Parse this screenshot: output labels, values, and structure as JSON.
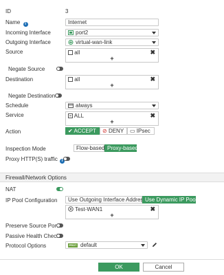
{
  "fields": {
    "id_label": "ID",
    "id_value": "3",
    "name_label": "Name",
    "name_value": "Internet",
    "incoming_label": "Incoming Interface",
    "incoming_value": "port2",
    "outgoing_label": "Outgoing Interface",
    "outgoing_value": "virtual-wan-link",
    "source_label": "Source",
    "source_value": "all",
    "negate_source_label": "Negate Source",
    "destination_label": "Destination",
    "destination_value": "all",
    "negate_destination_label": "Negate Destination",
    "schedule_label": "Schedule",
    "schedule_value": "always",
    "service_label": "Service",
    "service_value": "ALL",
    "action_label": "Action",
    "action_accept": "ACCEPT",
    "action_deny": "DENY",
    "action_ipsec": "IPsec",
    "inspection_label": "Inspection Mode",
    "inspection_flow": "Flow-based",
    "inspection_proxy": "Proxy-based",
    "proxy_http_label": "Proxy HTTP(S) traffic"
  },
  "section": {
    "title": "Firewall/Network Options",
    "nat_label": "NAT",
    "ip_pool_label": "IP Pool Configuration",
    "ip_pool_option1": "Use Outgoing Interface Address",
    "ip_pool_option2": "Use Dynamic IP Pool",
    "ip_pool_value": "Test-WAN1",
    "preserve_port_label": "Preserve Source Port",
    "passive_health_label": "Passive Health Check",
    "protocol_options_label": "Protocol Options",
    "protocol_options_badge": "PROT",
    "protocol_options_value": "default"
  },
  "footer": {
    "ok_label": "OK",
    "cancel_label": "Cancel"
  },
  "colors": {
    "accent": "#3c9a5f",
    "info": "#1e6fb5",
    "deny": "#d0312d"
  }
}
